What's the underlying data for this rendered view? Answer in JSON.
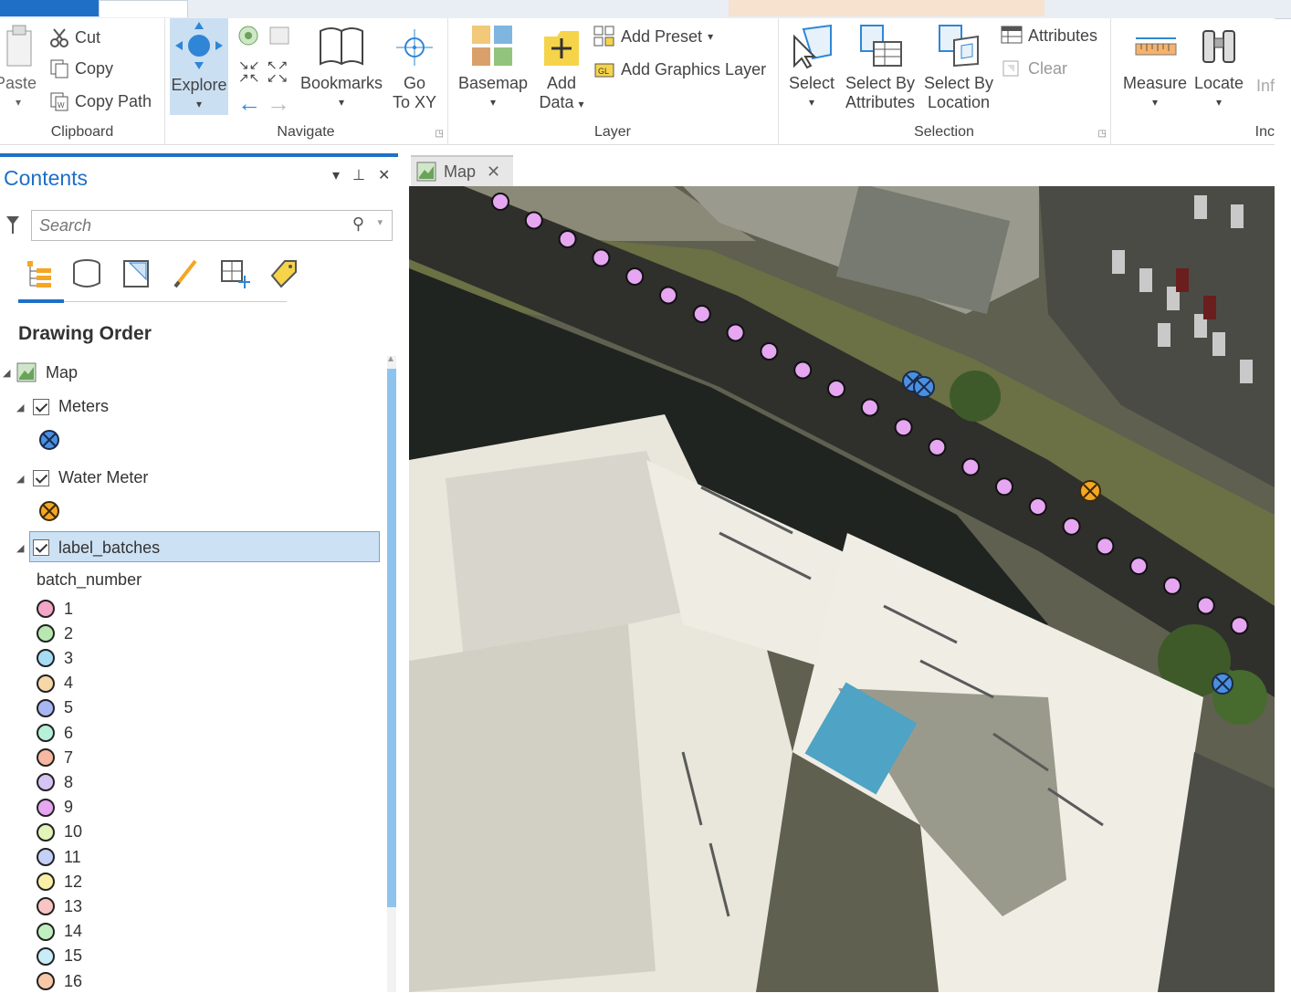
{
  "ribbon": {
    "clipboard": {
      "paste": "Paste",
      "cut": "Cut",
      "copy": "Copy",
      "copy_path": "Copy Path",
      "label": "Clipboard"
    },
    "navigate": {
      "explore": "Explore",
      "bookmarks": "Bookmarks",
      "go": "Go",
      "to_xy": "To XY",
      "label": "Navigate"
    },
    "layer": {
      "basemap": "Basemap",
      "add": "Add",
      "data": "Data",
      "add_preset": "Add Preset",
      "add_graphics_layer": "Add Graphics Layer",
      "label": "Layer"
    },
    "selection": {
      "select": "Select",
      "select_by": "Select By",
      "attributes": "Attributes",
      "location": "Location",
      "attributes_btn": "Attributes",
      "clear": "Clear",
      "label": "Selection"
    },
    "inquiry": {
      "measure": "Measure",
      "locate": "Locate",
      "info": "Inf",
      "label": "Inc"
    }
  },
  "contents": {
    "title": "Contents",
    "search_placeholder": "Search",
    "drawing_order": "Drawing Order",
    "map_label": "Map",
    "layers": [
      {
        "name": "Meters",
        "symbol_color": "#4a90e2"
      },
      {
        "name": "Water Meter",
        "symbol_color": "#f5a623"
      },
      {
        "name": "label_batches",
        "field": "batch_number"
      }
    ],
    "batches": [
      {
        "label": "1",
        "color": "#f4a6c6"
      },
      {
        "label": "2",
        "color": "#b8e8b0"
      },
      {
        "label": "3",
        "color": "#a6dcf4"
      },
      {
        "label": "4",
        "color": "#f6d8a8"
      },
      {
        "label": "5",
        "color": "#a8b6f2"
      },
      {
        "label": "6",
        "color": "#b6f0d8"
      },
      {
        "label": "7",
        "color": "#f6b8a0"
      },
      {
        "label": "8",
        "color": "#d6c4f4"
      },
      {
        "label": "9",
        "color": "#e6a6f2"
      },
      {
        "label": "10",
        "color": "#e4f4b8"
      },
      {
        "label": "11",
        "color": "#c4d0f8"
      },
      {
        "label": "12",
        "color": "#f8f0a6"
      },
      {
        "label": "13",
        "color": "#f8c4c4"
      },
      {
        "label": "14",
        "color": "#c0f0c0"
      },
      {
        "label": "15",
        "color": "#c8ecf8"
      },
      {
        "label": "16",
        "color": "#f8c8a8"
      }
    ]
  },
  "map": {
    "tab_label": "Map",
    "point_color": "#e6a6f2",
    "meter_color": "#4a90e2",
    "water_meter_color": "#f5a623"
  }
}
